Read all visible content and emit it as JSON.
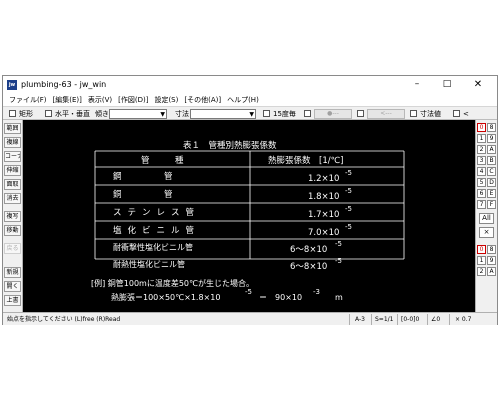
{
  "window": {
    "app_icon": "jw",
    "title": "plumbing-63 - jw_win",
    "minimize": "–",
    "maximize": "□",
    "close": "✕"
  },
  "menu": [
    "ファイル(F)",
    "[編集(E)]",
    "表示(V)",
    "[作図(D)]",
    "設定(S)",
    "[その他(A)]",
    "ヘルプ(H)"
  ],
  "toolbar": {
    "rect_label": "矩形",
    "hv_label": "水平・垂直",
    "slope_label": "傾き",
    "dim_label": "寸法",
    "deg15_label": "15度毎",
    "btn_dots": "●---",
    "btn_arrow": "<---",
    "dim_value_label": "寸法値",
    "lt_label": "<"
  },
  "left_tools": [
    "範囲",
    "複線",
    "コーナー",
    "伸縮",
    "面取",
    "消去",
    "複写",
    "移動",
    "戻る",
    "新規",
    "開く",
    "上書"
  ],
  "right_tools": {
    "layer_row1": [
      "0",
      "8"
    ],
    "layer_row2": [
      "1",
      "9"
    ],
    "layer_row3": [
      "2",
      "A"
    ],
    "layer_row4": [
      "3",
      "B"
    ],
    "layer_row5": [
      "4",
      "C"
    ],
    "layer_row6": [
      "5",
      "D"
    ],
    "layer_row7": [
      "6",
      "E"
    ],
    "layer_row8": [
      "7",
      "F"
    ],
    "all_label": "All",
    "x_label": "×",
    "group_row1": [
      "0",
      "8"
    ],
    "group_row2": [
      "1",
      "9"
    ],
    "group_row3": [
      "2",
      "A"
    ]
  },
  "drawing": {
    "table_title": "表１　管種別熱膨張係数",
    "col_pipe": "管　　　種",
    "col_coef": "熱膨張係数　[1/℃]",
    "rows": [
      {
        "pipe": "鋼　　　　　管",
        "mantissa": "1.2×10",
        "exp": "-5"
      },
      {
        "pipe": "銅　　　　　管",
        "mantissa": "1.8×10",
        "exp": "-5"
      },
      {
        "pipe": "ステンレス管",
        "mantissa": "1.7×10",
        "exp": "-5"
      },
      {
        "pipe": "塩化ビニル管",
        "mantissa": "7.0×10",
        "exp": "-5"
      },
      {
        "pipe": "耐衝撃性塩化ビニル管",
        "mantissa": "6〜8×10",
        "exp": "-5"
      },
      {
        "pipe": "耐熱性塩化ビニル管",
        "mantissa": "6〜8×10",
        "exp": "-5"
      }
    ],
    "example_line1": "[例] 銅管100mに温度差50℃が生じた場合。",
    "example_line2_a": "熱膨張＝100×50℃×1.8×10",
    "example_line2_exp1": "-5",
    "example_line2_b": "＝　90×10",
    "example_line2_exp2": "-3",
    "example_line2_unit": "m"
  },
  "status": {
    "prompt": "始点を指示してください (L)free (R)Read",
    "scale": "A-3",
    "ratio": "S=1/1",
    "layer": "[0-0]0",
    "angle": "∠0",
    "zoom": "× 0.7"
  }
}
